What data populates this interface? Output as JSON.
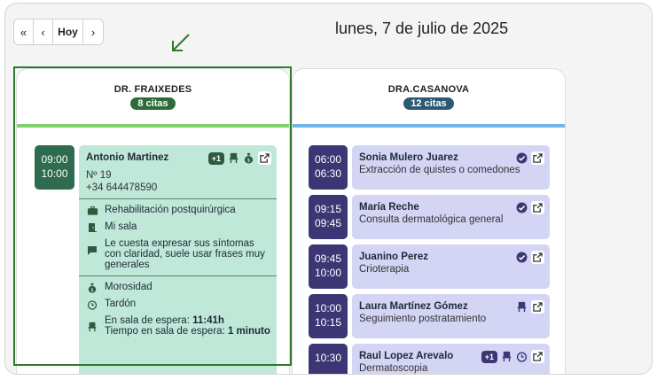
{
  "nav": {
    "first": "«",
    "prev": "‹",
    "today": "Hoy",
    "next": "›"
  },
  "date_title": "lunes, 7 de julio de 2025",
  "colors": {
    "green_accent": "#7fcf6a",
    "blue_accent": "#6fb6e6",
    "green_time": "#2f6b4f",
    "green_card": "#bfe8d8",
    "purple_time": "#3c3774",
    "purple_card": "#d4d4f5",
    "highlight": "#2d7a2d"
  },
  "columns": [
    {
      "doctor": "DR. FRAIXEDES",
      "count": "8 citas",
      "appointments": [
        {
          "start": "09:00",
          "end": "10:00",
          "patient": "Antonio Martinez",
          "number": "Nº 19",
          "phone": "+34 644478590",
          "extra_badge": "+1",
          "icons": [
            "chair-icon",
            "money-bag-icon",
            "external-link-icon"
          ],
          "details": [
            {
              "icon": "briefcase-medical-icon",
              "text": "Rehabilitación postquirúrgica"
            },
            {
              "icon": "door-icon",
              "text": "Mi sala"
            },
            {
              "icon": "comment-icon",
              "text": "Le cuesta expresar sus síntomas con claridad, suele usar frases muy generales"
            }
          ],
          "flags": [
            {
              "icon": "money-bag-icon",
              "text": "Morosidad"
            },
            {
              "icon": "alarm-clock-icon",
              "text": "Tardón"
            }
          ],
          "waiting": {
            "label1": "En sala de espera: ",
            "value1": "11:41h",
            "label2": "Tiempo en sala de espera: ",
            "value2": "1 minuto"
          }
        }
      ]
    },
    {
      "doctor": "DRA.CASANOVA",
      "count": "12 citas",
      "appointments": [
        {
          "start": "06:00",
          "end": "06:30",
          "patient": "Sonia Mulero Juarez",
          "service": "Extracción de quistes o comedones",
          "icons": [
            "check-circle-icon",
            "external-link-icon"
          ]
        },
        {
          "start": "09:15",
          "end": "09:45",
          "patient": "María Reche",
          "service": "Consulta dermatológica general",
          "icons": [
            "check-circle-icon",
            "external-link-icon"
          ]
        },
        {
          "start": "09:45",
          "end": "10:00",
          "patient": "Juanino Perez",
          "service": "Crioterapia",
          "icons": [
            "check-circle-icon",
            "external-link-icon"
          ]
        },
        {
          "start": "10:00",
          "end": "10:15",
          "patient": "Laura Martínez Gómez",
          "service": "Seguimiento postratamiento",
          "icons": [
            "chair-icon",
            "external-link-icon"
          ]
        },
        {
          "start": "10:30",
          "end": "",
          "patient": "Raul Lopez Arevalo",
          "service": "Dermatoscopia",
          "extra_badge": "+1",
          "icons": [
            "chair-icon",
            "alarm-clock-icon",
            "external-link-icon"
          ]
        }
      ]
    }
  ]
}
